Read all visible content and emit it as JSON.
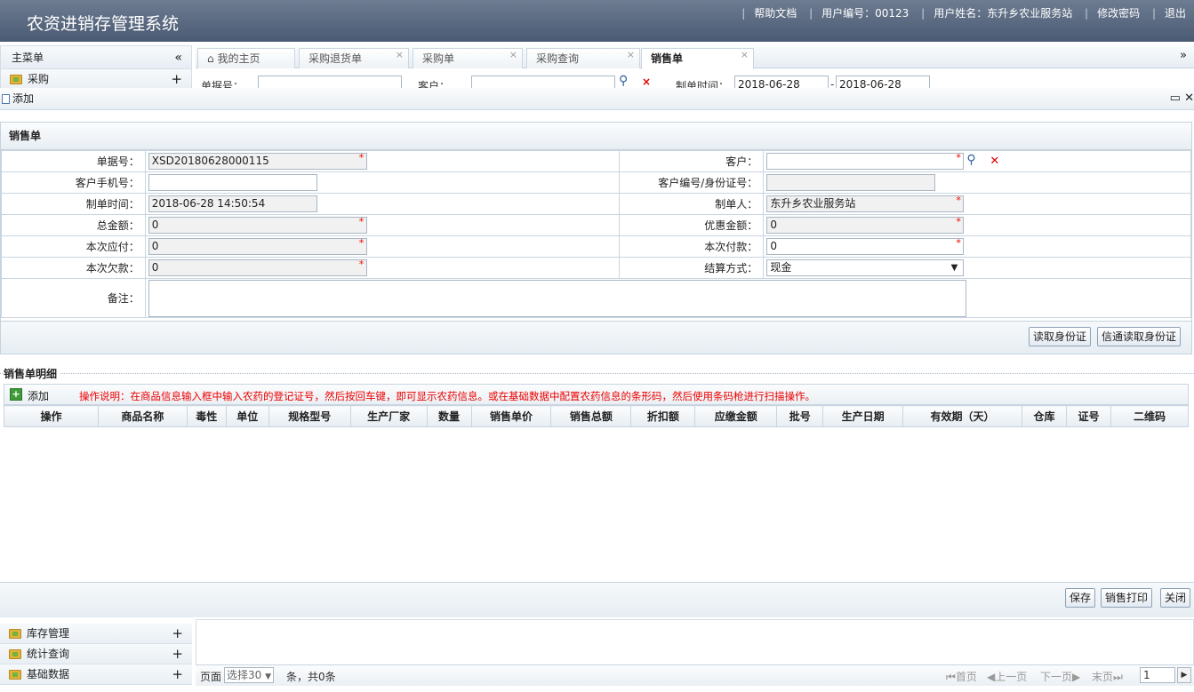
{
  "app": {
    "title": "农资进销存管理系统"
  },
  "top_links": {
    "help": "帮助文档",
    "user_id": "用户编号：00123",
    "user_name": "用户姓名：东升乡农业服务站",
    "change_pwd": "修改密码",
    "logout": "退出"
  },
  "left_panel": {
    "title": "主菜单",
    "items": [
      {
        "label": "采购"
      }
    ],
    "bottom_items": [
      {
        "label": "库存管理"
      },
      {
        "label": "统计查询"
      },
      {
        "label": "基础数据"
      }
    ]
  },
  "tabs": [
    {
      "label": "我的主页"
    },
    {
      "label": "采购退货单"
    },
    {
      "label": "采购单"
    },
    {
      "label": "采购查询"
    },
    {
      "label": "销售单"
    }
  ],
  "search_bar": {
    "doc_no_label": "单据号：",
    "customer_label": "客户：",
    "date_label": "制单时间：",
    "date_from": "2018-06-28",
    "date_sep": "-",
    "date_to": "2018-06-28"
  },
  "dialog": {
    "title": "添加"
  },
  "form": {
    "section_title": "销售单",
    "doc_no_label": "单据号：",
    "doc_no": "XSD20180628000115",
    "customer_label": "客户：",
    "customer": "",
    "phone_label": "客户手机号：",
    "phone": "",
    "cust_id_label": "客户编号/身份证号：",
    "cust_id": "",
    "created_label": "制单时间：",
    "created": "2018-06-28 14:50:54",
    "maker_label": "制单人：",
    "maker": "东升乡农业服务站",
    "total_label": "总金额：",
    "total": "0",
    "discount_label": "优惠金额：",
    "discount": "0",
    "payable_label": "本次应付：",
    "payable": "0",
    "paid_label": "本次付款：",
    "paid": "0",
    "owed_label": "本次欠款：",
    "owed": "0",
    "settle_label": "结算方式：",
    "settle": "现金",
    "remark_label": "备注：",
    "remark": "",
    "read_id_btn": "读取身份证",
    "xt_read_id_btn": "信通读取身份证"
  },
  "detail": {
    "title": "销售单明细",
    "add_label": "添加",
    "hint": "操作说明：在商品信息输入框中输入农药的登记证号，然后按回车键，即可显示农药信息。或在基础数据中配置农药信息的条形码，然后使用条码枪进行扫描操作。",
    "columns": [
      "操作",
      "商品名称",
      "毒性",
      "单位",
      "规格型号",
      "生产厂家",
      "数量",
      "销售单价",
      "销售总额",
      "折扣额",
      "应缴金额",
      "批号",
      "生产日期",
      "有效期（天）",
      "仓库",
      "证号",
      "二维码"
    ]
  },
  "actions": {
    "save": "保存",
    "print": "销售打印",
    "close": "关闭"
  },
  "pager": {
    "page_label": "页面",
    "page_size": "选择30",
    "summary": "条，共0条",
    "first": "首页",
    "prev": "上一页",
    "next": "下一页",
    "last": "末页",
    "page_no": "1"
  }
}
